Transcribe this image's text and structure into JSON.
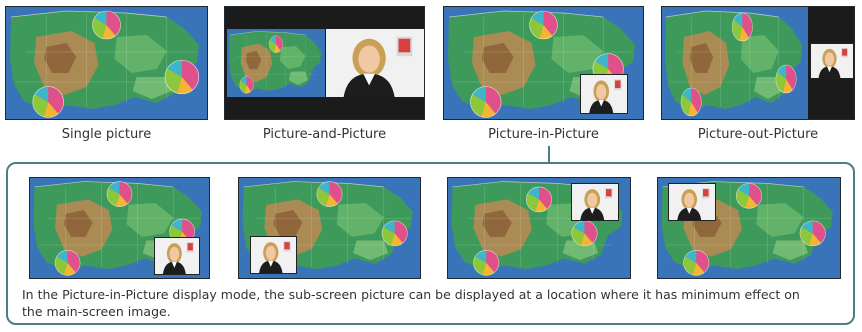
{
  "modes": {
    "single": "Single picture",
    "pap": "Picture-and-Picture",
    "pip": "Picture-in-Picture",
    "pop": "Picture-out-Picture"
  },
  "caption": "In the Picture-in-Picture display mode, the sub-screen picture can be displayed at a location where it has minimum effect on the main-screen image.",
  "icons": {
    "map": "us-weather-map",
    "pie": "pie-chart-icon",
    "presenter": "presenter-video-icon"
  },
  "colors": {
    "frame": "#4c7d86",
    "ocean": "#3a74b8",
    "land": "#3e9a5a",
    "desert": "#b58a52",
    "pie_pink": "#e0508a",
    "pie_yellow": "#f2b632",
    "pie_cyan": "#3cb6c8"
  }
}
